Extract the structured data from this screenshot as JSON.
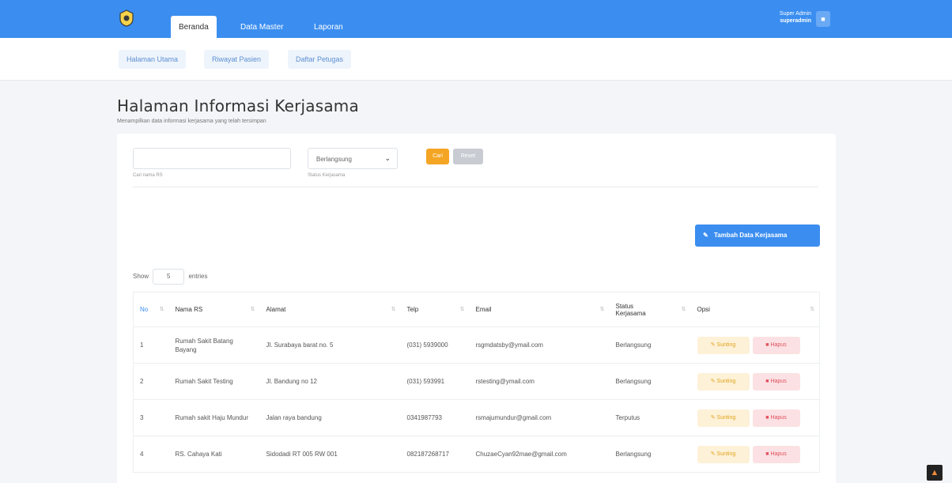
{
  "topbar": {
    "tabs": [
      {
        "label": "Beranda"
      },
      {
        "label": "Data Master"
      },
      {
        "label": "Laporan"
      }
    ],
    "user": {
      "role": "Super Admin",
      "name": "superadmin"
    }
  },
  "subnav": {
    "tabs": [
      {
        "label": "Halaman Utama"
      },
      {
        "label": "Riwayat Pasien"
      },
      {
        "label": "Daftar Petugas"
      }
    ]
  },
  "page": {
    "title": "Halaman Informasi Kerjasama",
    "subtitle": "Menampilkan data informasi kerjasama yang telah tersimpan"
  },
  "filter": {
    "search_value": "",
    "search_hint": "Cari nama RS",
    "status_value": "Berlangsung",
    "status_hint": "Status Kerjasama",
    "cari_label": "Cari",
    "reset_label": "Reset"
  },
  "add_button": {
    "label": "Tambah Data Kerjasama"
  },
  "show": {
    "prefix": "Show",
    "value": "5",
    "suffix": "entries"
  },
  "table": {
    "headers": [
      "No",
      "Nama RS",
      "Alamat",
      "Telp",
      "Email",
      "Status Kerjasama",
      "Opsi"
    ],
    "edit_label": "Sunting",
    "delete_label": "Hapus",
    "rows": [
      {
        "no": "1",
        "nama": "Rumah Sakit Batang Bayang",
        "alamat": "Jl. Surabaya barat no. 5",
        "telp": "(031) 5939000",
        "email": "rsgmdatsby@ymail.com",
        "status": "Berlangsung"
      },
      {
        "no": "2",
        "nama": "Rumah Sakit Testing",
        "alamat": "Jl. Bandung no 12",
        "telp": "(031) 593991",
        "email": "rstesting@ymail.com",
        "status": "Berlangsung"
      },
      {
        "no": "3",
        "nama": "Rumah sakit Haju Mundur",
        "alamat": "Jalan raya bandung",
        "telp": "0341987793",
        "email": "rsmajumundur@gmail.com",
        "status": "Terputus"
      },
      {
        "no": "4",
        "nama": "RS. Cahaya Kati",
        "alamat": "Sidodadi RT 005 RW 001",
        "telp": "082187268717",
        "email": "ChuzaeCyan92mae@gmail.com",
        "status": "Berlangsung"
      }
    ]
  },
  "colors": {
    "primary": "#3b8ef0",
    "warning": "#f5a524",
    "danger": "#e0505f"
  }
}
